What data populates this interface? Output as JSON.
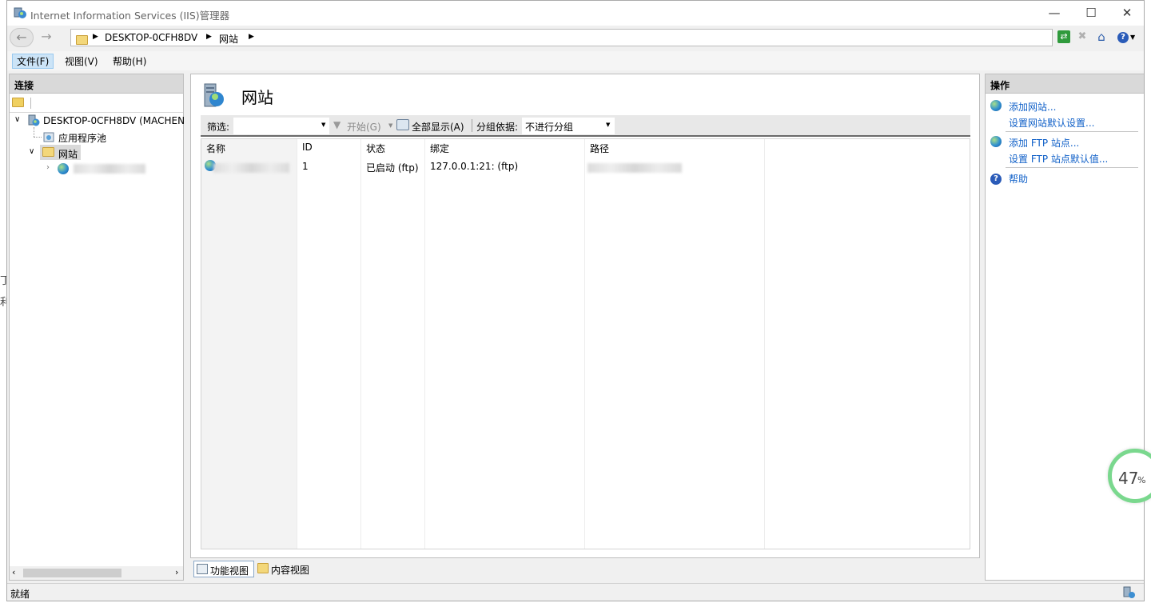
{
  "window": {
    "title": "Internet Information Services (IIS)管理器"
  },
  "nav": {
    "breadcrumb": [
      "DESKTOP-0CFH8DV",
      "网站"
    ]
  },
  "menu": {
    "items": [
      "文件(F)",
      "视图(V)",
      "帮助(H)"
    ]
  },
  "connections": {
    "title": "连接",
    "tree": {
      "server": "DESKTOP-0CFH8DV (MACHEN",
      "app_pools": "应用程序池",
      "sites": "网站"
    }
  },
  "main": {
    "title": "网站",
    "filter": {
      "label": "筛选:",
      "start": "开始(G)",
      "show_all": "全部显示(A)",
      "group_label": "分组依据:",
      "group_value": "不进行分组"
    },
    "columns": [
      "名称",
      "ID",
      "状态",
      "绑定",
      "路径"
    ],
    "rows": [
      {
        "id": "1",
        "status": "已启动 (ftp)",
        "binding": "127.0.0.1:21: (ftp)"
      }
    ],
    "views": {
      "features": "功能视图",
      "content": "内容视图"
    }
  },
  "actions": {
    "title": "操作",
    "items": [
      "添加网站...",
      "设置网站默认设置...",
      "添加 FTP 站点...",
      "设置 FTP 站点默认值...",
      "帮助"
    ]
  },
  "status": {
    "text": "就绪"
  },
  "overlay": {
    "percent": "47",
    "unit": "%"
  }
}
